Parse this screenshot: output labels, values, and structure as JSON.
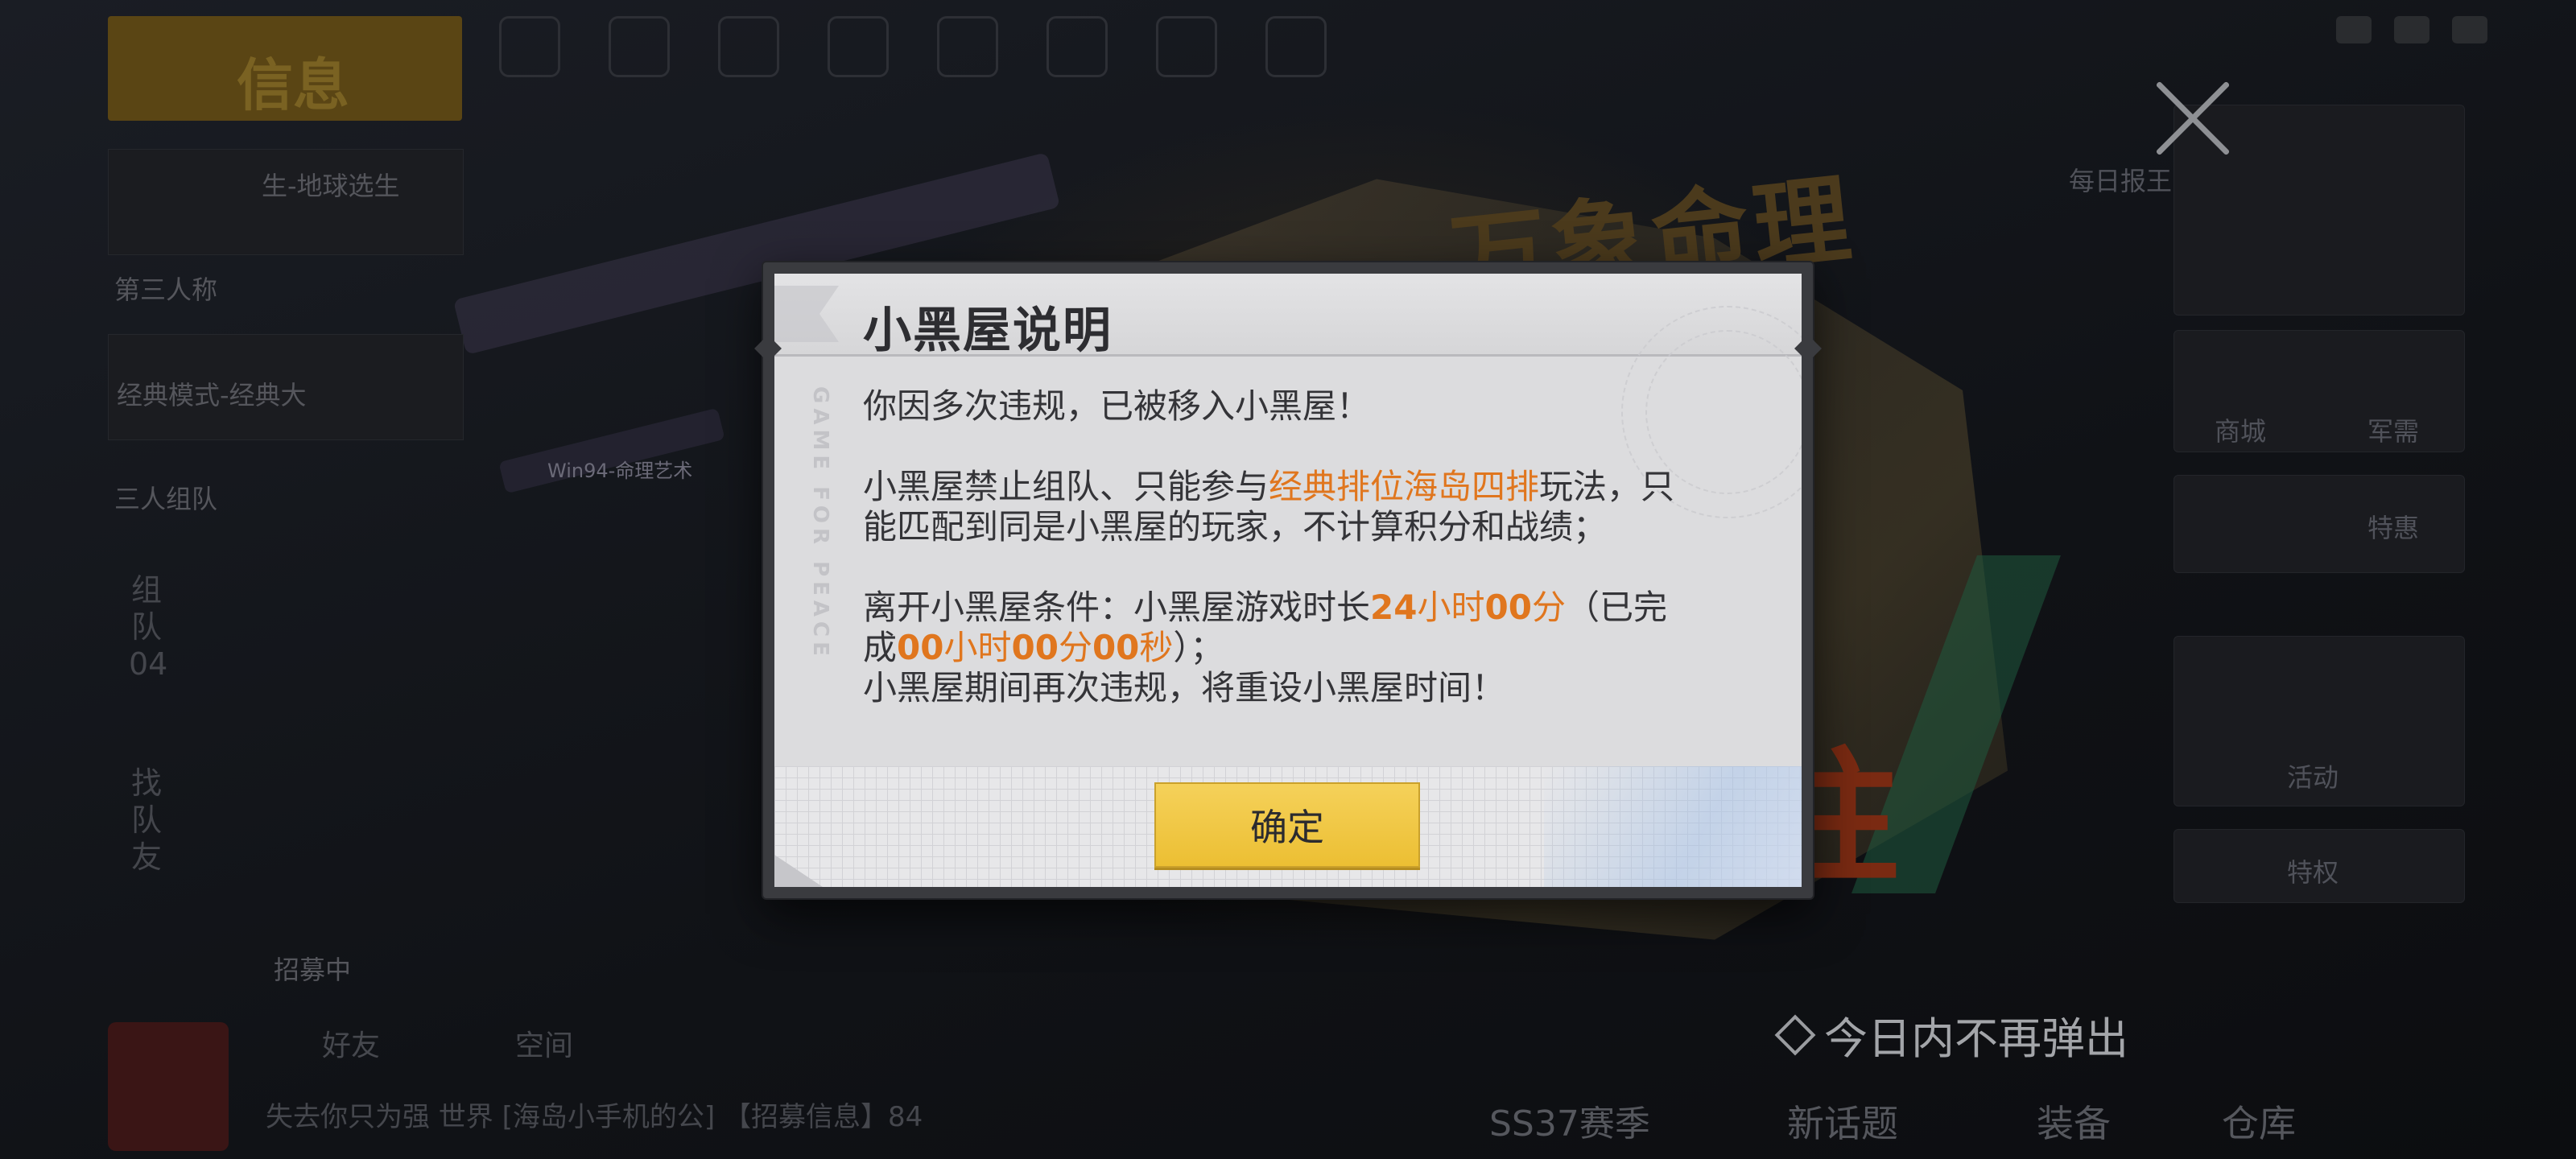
{
  "dialog": {
    "title": "小黑屋说明",
    "watermark": "GAME FOR PEACE",
    "line1": "你因多次违规，已被移入小黑屋！",
    "p2_pre": "小黑屋禁止组队、只能参与",
    "p2_highlight": "经典排位海岛四排",
    "p2_post_a": "玩法，只",
    "p2_post_b": "能匹配到同是小黑屋的玩家，不计算积分和战绩；",
    "p3_pre": "离开小黑屋条件：小黑屋游戏时长",
    "p3_required_h": "24",
    "p3_hour_unit": "小时",
    "p3_required_m": "00",
    "p3_min_unit": "分",
    "p3_mid_a": "（已完",
    "p3_mid_b": "成",
    "p3_done_h": "00",
    "p3_done_hour_unit": "小时",
    "p3_done_m": "00",
    "p3_done_min_unit": "分",
    "p3_done_s": "00",
    "p3_done_sec_unit": "秒",
    "p3_post": "）；",
    "p4": "小黑屋期间再次违规，将重设小黑屋时间！",
    "confirm_label": "确定"
  },
  "dont_show_label": "今日内不再弹出",
  "background": {
    "poster_title": "万象命理",
    "poster_char": "往",
    "weapon_tag": "Win94-命理艺术",
    "left_items": [
      "信息",
      "生-地球选生",
      "第三人称",
      "经典模式-经典大",
      "三人组队"
    ],
    "left_vertical_1": "组队04",
    "left_vertical_2": "找队友",
    "recruit_label": "招募中",
    "friends_label": "好友",
    "space_label": "空间",
    "chat_line": "失去你只为强  世界 [海岛小手机的公]  【招募信息】84",
    "season_label": "SS37赛季",
    "new_topic": "新话题",
    "equipment": "装备",
    "warehouse": "仓库",
    "right_labels": [
      "商城",
      "军需",
      "特惠",
      "活动",
      "特权"
    ],
    "right_top_label": "每日报王"
  },
  "colors": {
    "highlight": "#e0761e",
    "button_yellow": "#f0c63f",
    "dialog_bg": "#dcdcde"
  }
}
